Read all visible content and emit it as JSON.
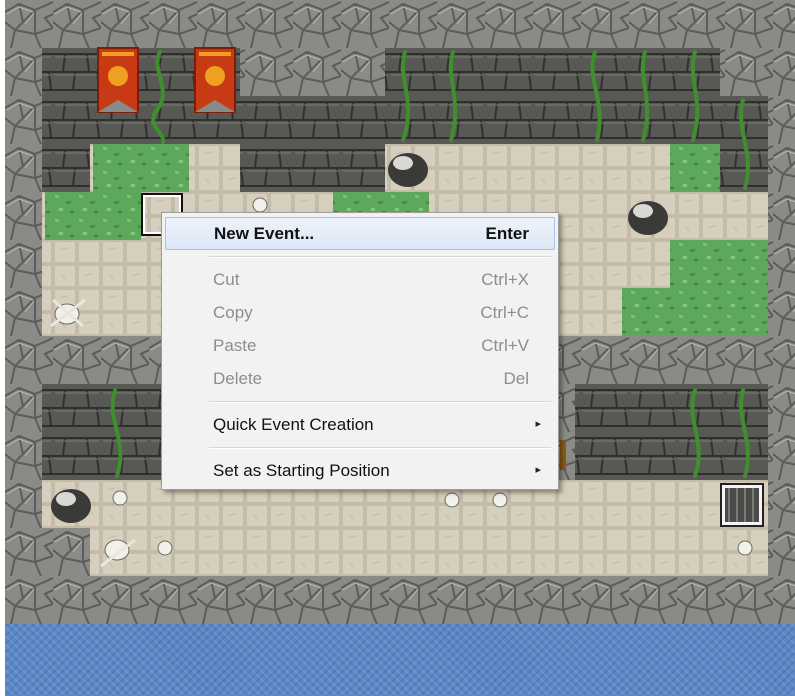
{
  "map": {
    "colors": {
      "stone_wall": "#8a8a86",
      "cliff": "#575753",
      "floor": "#d6cfbd",
      "grass": "#5ea85b",
      "banner": "#c83a14",
      "vine": "#3f8f2e",
      "water": "#5a88c8"
    },
    "icons": [
      "banner-icon",
      "vine-icon",
      "boulder-icon",
      "skull-bones-icon",
      "stairs-icon"
    ]
  },
  "context_menu": {
    "items": [
      {
        "label": "New Event...",
        "shortcut": "Enter"
      },
      {
        "label": "Cut",
        "shortcut": "Ctrl+X"
      },
      {
        "label": "Copy",
        "shortcut": "Ctrl+C"
      },
      {
        "label": "Paste",
        "shortcut": "Ctrl+V"
      },
      {
        "label": "Delete",
        "shortcut": "Del"
      },
      {
        "label": "Quick Event Creation"
      },
      {
        "label": "Set as Starting Position"
      }
    ],
    "submenu_arrow": "▸"
  }
}
